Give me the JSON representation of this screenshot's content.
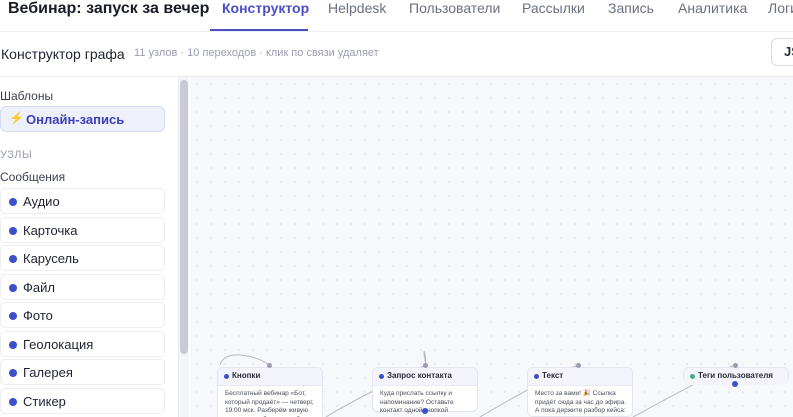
{
  "header": {
    "title": "Вебинар: запуск за вечер",
    "tabs": [
      {
        "label": "Конструктор"
      },
      {
        "label": "Helpdesk"
      },
      {
        "label": "Пользователи"
      },
      {
        "label": "Рассылки"
      },
      {
        "label": "Запись"
      },
      {
        "label": "Аналитика"
      },
      {
        "label": "Логи"
      }
    ]
  },
  "subheader": {
    "title": "Конструктор графа",
    "meta": "11 узлов · 10 переходов · клик по связи удаляет",
    "json_button": "JSON"
  },
  "sidebar": {
    "templates_label": "Шаблоны",
    "template_item": "Онлайн-запись",
    "nodes_label": "УЗЛЫ",
    "messages_label": "Сообщения",
    "items": [
      "Аудио",
      "Карточка",
      "Карусель",
      "Файл",
      "Фото",
      "Геолокация",
      "Галерея",
      "Стикер"
    ]
  },
  "canvas": {
    "nodes": [
      {
        "title": "Кнопки",
        "text": "Бесплатный вебинар «Бот, который продаёт» — четверг, 19:00 мск. Разберём живую воронку и забираем шаблон."
      },
      {
        "title": "Запрос контакта",
        "text": "Куда прислать ссылку и напоминание? Оставьте контакт одной кнопкой"
      },
      {
        "title": "Текст",
        "text": "Место за вами! 🎉 Ссылка придёт сюда за час до эфира. А пока держите разбор кейса: как"
      },
      {
        "title": "Теги пользователя",
        "text": ""
      }
    ]
  },
  "colors": {
    "accent": "#4b4fc7",
    "node_dot": "#3d4fc8",
    "tag_dot": "#3fae7b"
  }
}
